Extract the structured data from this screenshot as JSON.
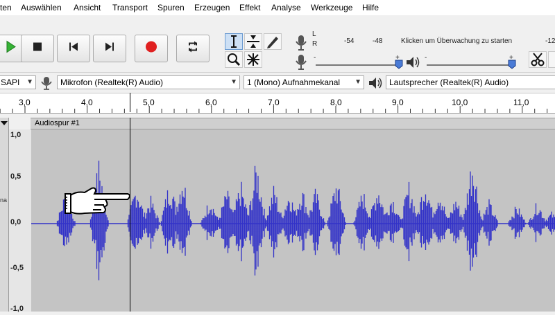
{
  "menu": [
    "ten",
    "Auswählen",
    "Ansicht",
    "Transport",
    "Spuren",
    "Erzeugen",
    "Effekt",
    "Analyse",
    "Werkzeuge",
    "Hilfe"
  ],
  "meter": {
    "lr": [
      "L",
      "R"
    ],
    "ticks": [
      "-54",
      "-48"
    ],
    "start_text": "Klicken um Überwachung zu starten",
    "right_tick": "-12",
    "minus": "-",
    "plus": "+"
  },
  "devices": {
    "host": "SAPI",
    "mic": "Mikrofon (Realtek(R) Audio)",
    "channels": "1 (Mono) Aufnahmekanal",
    "speaker": "Lautsprecher (Realtek(R) Audio)"
  },
  "ruler_ticks": [
    "3,0",
    "4,0",
    "5,0",
    "6,0",
    "7,0",
    "8,0",
    "9,0",
    "10,0",
    "11,0"
  ],
  "track": {
    "name": "Audiospur #1",
    "scale": [
      "1,0",
      "0,5",
      "0,0",
      "-0,5",
      "-1,0"
    ],
    "side_text": "na"
  },
  "colors": {
    "wave": "#3232c8",
    "play": "#36b336",
    "record": "#e02020"
  }
}
